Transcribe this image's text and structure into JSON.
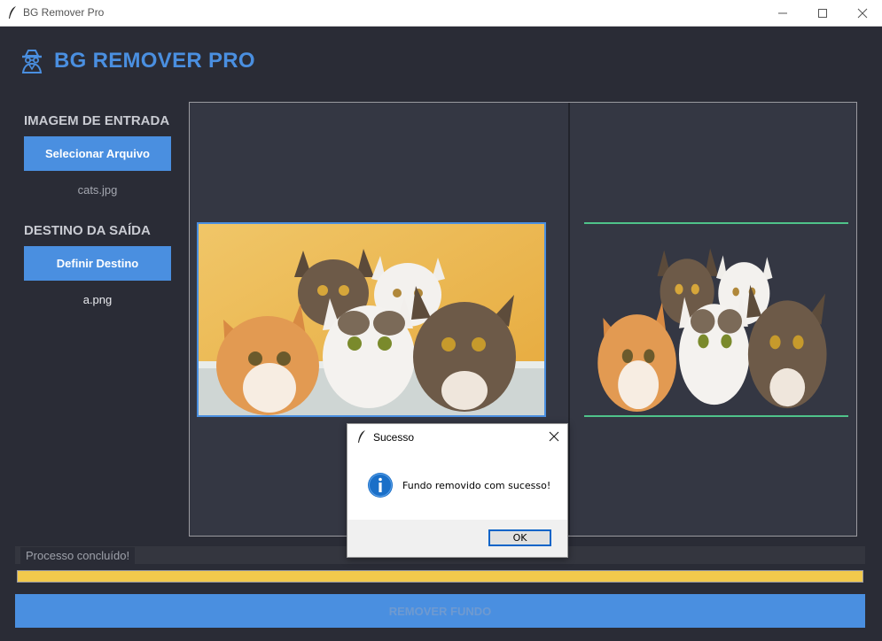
{
  "window": {
    "title": "BG Remover Pro"
  },
  "header": {
    "title": "BG REMOVER PRO"
  },
  "input_section": {
    "title": "IMAGEM DE ENTRADA",
    "button_label": "Selecionar Arquivo",
    "file_name": "cats.jpg"
  },
  "output_section": {
    "title": "DESTINO DA SAÍDA",
    "button_label": "Definir Destino",
    "file_name": "a.png"
  },
  "status": {
    "text": "Processo concluído!",
    "progress_percent": 100
  },
  "action": {
    "button_label": "REMOVER FUNDO"
  },
  "dialog": {
    "title": "Sucesso",
    "message": "Fundo removido com sucesso!",
    "ok_label": "OK"
  },
  "colors": {
    "accent": "#4a8fe0",
    "background": "#2a2c36",
    "progress": "#f2c94c",
    "success_border": "#4fc38a"
  }
}
